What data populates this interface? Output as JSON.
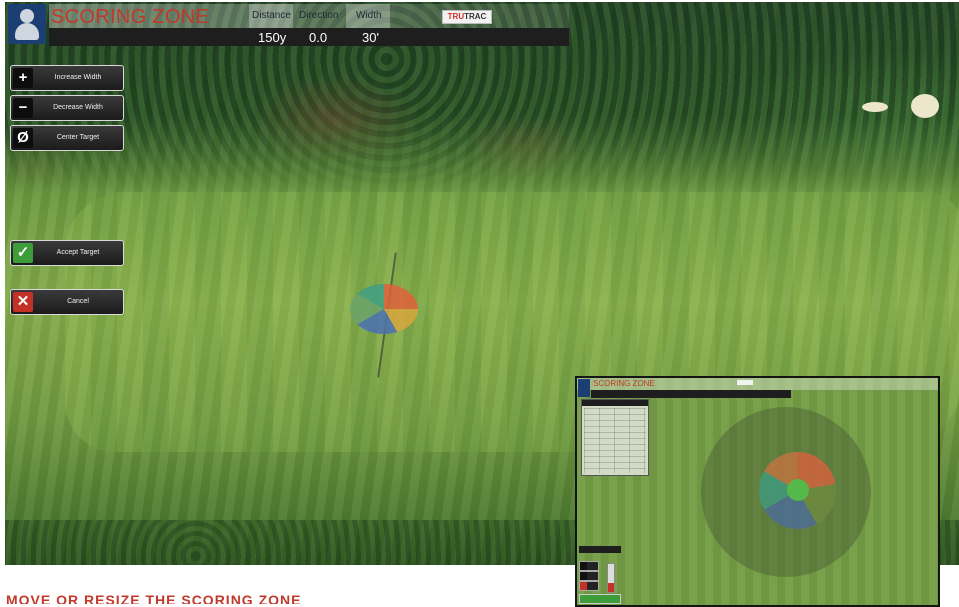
{
  "hud": {
    "title": "SCORING ZONE",
    "headers": [
      "Distance",
      "Direction",
      "Width"
    ],
    "values": [
      "150y",
      "0.0",
      "30'"
    ],
    "brand": {
      "part1": "TRU",
      "part2": "TRAC"
    }
  },
  "controls": {
    "increase_width": "Increase Width",
    "decrease_width": "Decrease Width",
    "center_target": "Center Target",
    "accept_target": "Accept Target",
    "cancel": "Cancel",
    "icons": {
      "increase": "plus-icon",
      "decrease": "minus-icon",
      "center": "slashed-circle-icon",
      "accept": "check-icon",
      "cancel": "x-icon"
    },
    "symbols": {
      "increase": "+",
      "decrease": "−",
      "center": "Ø",
      "accept": "✓",
      "cancel": "✕"
    }
  },
  "caption": "MOVE OR RESIZE THE SCORING ZONE",
  "colors": {
    "title_red": "#c0392b",
    "accept_green": "#3f9c3b",
    "cancel_red": "#c43227",
    "logo_blue": "#1c3f73"
  }
}
